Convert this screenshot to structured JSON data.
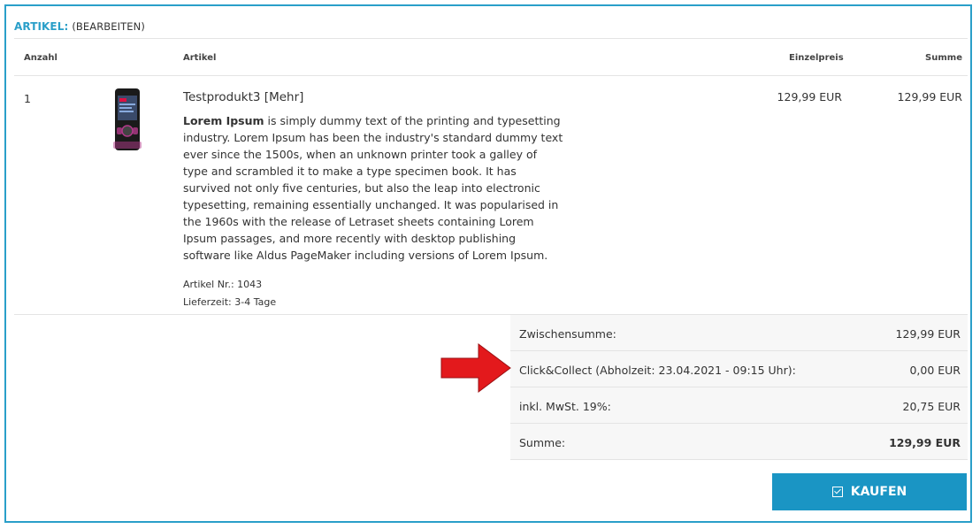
{
  "header": {
    "section_label": "ARTIKEL:",
    "edit_label": "(BEARBEITEN)"
  },
  "table": {
    "columns": {
      "qty": "Anzahl",
      "article": "Artikel",
      "unit_price": "Einzelpreis",
      "sum": "Summe"
    }
  },
  "item": {
    "qty": "1",
    "name": "Testprodukt3",
    "more_link": "[Mehr]",
    "desc_bold": "Lorem Ipsum",
    "desc_rest": " is simply dummy text of the printing and typesetting industry. Lorem Ipsum has been the industry's standard dummy text ever since the 1500s, when an unknown printer took a galley of type and scrambled it to make a type specimen book. It has survived not only five centuries, but also the leap into electronic typesetting, remaining essentially unchanged. It was popularised in the 1960s with the release of Letraset sheets containing Lorem Ipsum passages, and more recently with desktop publishing software like Aldus PageMaker including versions of Lorem Ipsum.",
    "article_no": "Artikel Nr.: 1043",
    "delivery": "Lieferzeit: 3-4 Tage",
    "unit_price": "129,99 EUR",
    "sum": "129,99 EUR",
    "image_icon": "phone-product-image"
  },
  "totals": [
    {
      "label": "Zwischensumme:",
      "value": "129,99 EUR",
      "bold": false
    },
    {
      "label": "Click&Collect (Abholzeit: 23.04.2021 - 09:15 Uhr):",
      "value": "0,00 EUR",
      "bold": false
    },
    {
      "label": "inkl. MwSt. 19%:",
      "value": "20,75 EUR",
      "bold": false
    },
    {
      "label": "Summe:",
      "value": "129,99 EUR",
      "bold": true
    }
  ],
  "buy_button": {
    "label": "KAUFEN",
    "icon": "check-square-icon"
  },
  "colors": {
    "accent": "#2a9fc9",
    "button": "#1a95c4",
    "arrow": "#e3191c"
  }
}
